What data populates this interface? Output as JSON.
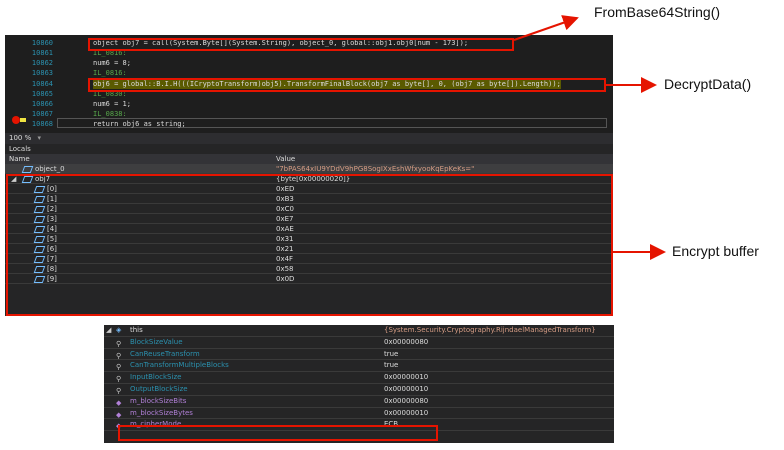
{
  "annotations": {
    "from_base64": "FromBase64String()",
    "decrypt_data": "DecryptData()",
    "encrypt_buffer": "Encrypt buffer"
  },
  "code_lines": [
    {
      "num": "10860",
      "text": "object obj7 = call(System.Byte[](System.String), object_0, global::obj1.obj0[num - 173]);"
    },
    {
      "num": "10861",
      "text": "IL_0816:"
    },
    {
      "num": "10862",
      "text": "num6 = 8;"
    },
    {
      "num": "10863",
      "text": "IL_0816:"
    },
    {
      "num": "10864",
      "text": "obj6 = global::B.I.H(((ICryptoTransform)obj5).TransformFinalBlock(obj7 as byte[], 0, (obj7 as byte[]).Length));"
    },
    {
      "num": "10865",
      "text": "IL_0830:"
    },
    {
      "num": "10866",
      "text": "num6 = 1;"
    },
    {
      "num": "10867",
      "text": "IL_0838:"
    },
    {
      "num": "10868",
      "text": "return obj6 as string;"
    }
  ],
  "zoom": "100 %",
  "locals": {
    "title": "Locals",
    "col_name": "Name",
    "col_value": "Value",
    "rows": [
      {
        "name": "object_0",
        "value": "\"7bPAS64xIU9YDdV9hPG8SogIXxEshWfxyooKqEpKeKs=\""
      },
      {
        "name": "obj7",
        "value": "{byte[0x00000020]}"
      },
      {
        "name": "[0]",
        "value": "0xED"
      },
      {
        "name": "[1]",
        "value": "0xB3"
      },
      {
        "name": "[2]",
        "value": "0xC0"
      },
      {
        "name": "[3]",
        "value": "0xE7"
      },
      {
        "name": "[4]",
        "value": "0xAE"
      },
      {
        "name": "[5]",
        "value": "0x31"
      },
      {
        "name": "[6]",
        "value": "0x21"
      },
      {
        "name": "[7]",
        "value": "0x4F"
      },
      {
        "name": "[8]",
        "value": "0x58"
      },
      {
        "name": "[9]",
        "value": "0x0D"
      }
    ]
  },
  "this_panel": {
    "root_name": "this",
    "root_value": "{System.Security.Cryptography.RijndaelManagedTransform}",
    "rows": [
      {
        "name": "BlockSizeValue",
        "value": "0x00000080"
      },
      {
        "name": "CanReuseTransform",
        "value": "true"
      },
      {
        "name": "CanTransformMultipleBlocks",
        "value": "true"
      },
      {
        "name": "InputBlockSize",
        "value": "0x00000010"
      },
      {
        "name": "OutputBlockSize",
        "value": "0x00000010"
      },
      {
        "name": "m_blockSizeBits",
        "value": "0x00000080"
      },
      {
        "name": "m_blockSizeBytes",
        "value": "0x00000010"
      },
      {
        "name": "m_cipherMode",
        "value": "ECB"
      }
    ]
  }
}
